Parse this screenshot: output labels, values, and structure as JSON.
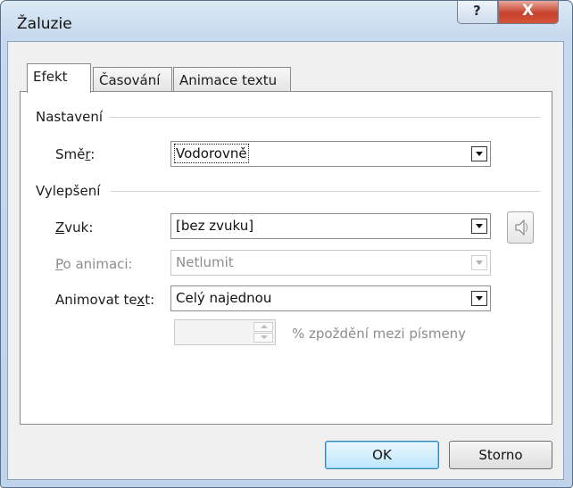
{
  "window": {
    "title": "Žaluzie",
    "help_glyph": "?",
    "close_glyph": "X"
  },
  "tabs": [
    {
      "label": "Efekt",
      "active": true
    },
    {
      "label": "Časování",
      "active": false
    },
    {
      "label": "Animace textu",
      "active": false
    }
  ],
  "settings": {
    "group_label": "Nastavení",
    "direction": {
      "label_pre": "Smě",
      "label_accel": "r",
      "label_post": ":",
      "value": "Vodorovně"
    }
  },
  "enhancements": {
    "group_label": "Vylepšení",
    "sound": {
      "label_accel": "Z",
      "label_post": "vuk:",
      "value": "[bez zvuku]"
    },
    "after_animation": {
      "label_accel": "P",
      "label_post": "o animaci:",
      "value": "Netlumit",
      "disabled": true
    },
    "animate_text": {
      "label_pre": "Animovat te",
      "label_accel": "x",
      "label_post": "t:",
      "value": "Celý najednou"
    },
    "delay": {
      "value": "",
      "suffix_pre": "% zpoždění",
      "suffix_accel": "",
      "suffix_post": " mezi písmeny",
      "disabled": true
    }
  },
  "buttons": {
    "ok": "OK",
    "cancel": "Storno"
  },
  "icons": {
    "speaker": "speaker-icon"
  }
}
